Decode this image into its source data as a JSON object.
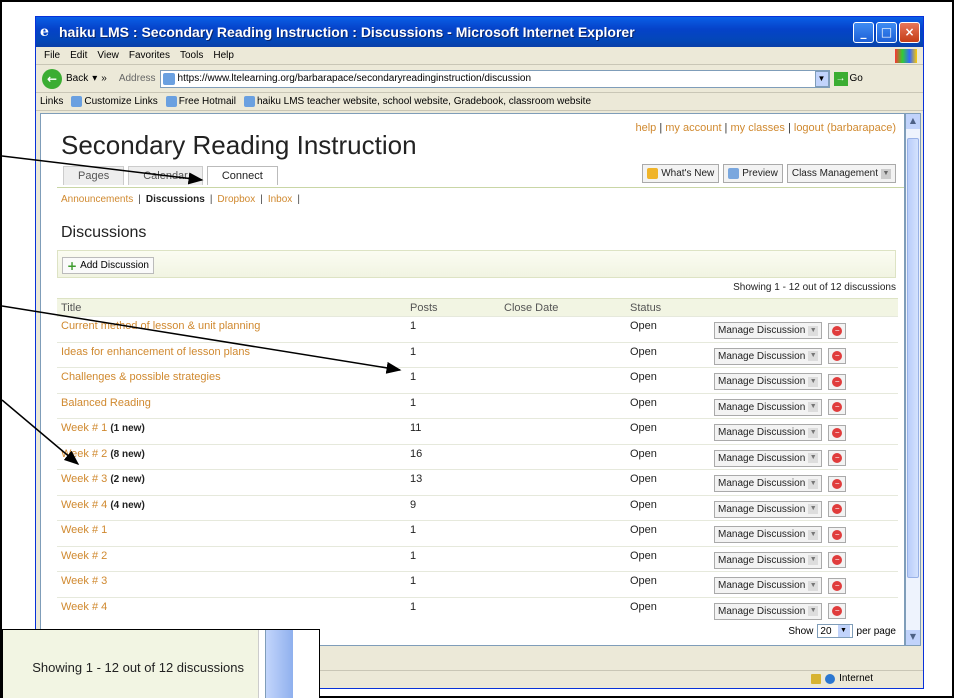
{
  "window": {
    "title": "haiku LMS : Secondary Reading Instruction : Discussions - Microsoft Internet Explorer",
    "menu": [
      "File",
      "Edit",
      "View",
      "Favorites",
      "Tools",
      "Help"
    ],
    "back_label": "Back",
    "address_label": "Address",
    "url": "https://www.ltelearning.org/barbarapace/secondaryreadinginstruction/discussion",
    "go_label": "Go",
    "links_label": "Links",
    "links": [
      "Customize Links",
      "Free Hotmail",
      "haiku LMS teacher website, school website, Gradebook, classroom website"
    ],
    "status_zone": "Internet"
  },
  "lms": {
    "top_links": [
      "help",
      "my account",
      "my classes",
      "logout (barbarapace)"
    ],
    "course_title": "Secondary Reading Instruction",
    "tabs": [
      "Pages",
      "Calendar",
      "Connect"
    ],
    "buttons": [
      "What's New",
      "Preview",
      "Class Management"
    ],
    "subnav": [
      "Announcements",
      "Discussions",
      "Dropbox",
      "Inbox"
    ],
    "page_heading": "Discussions",
    "add_button": "Add Discussion",
    "showing": "Showing 1 - 12 out of 12 discussions",
    "columns": [
      "Title",
      "Posts",
      "Close Date",
      "Status"
    ],
    "rows": [
      {
        "title": "Current method of lesson & unit planning",
        "new": "",
        "posts": "1",
        "close": "",
        "status": "Open"
      },
      {
        "title": "Ideas for enhancement of lesson plans",
        "new": "",
        "posts": "1",
        "close": "",
        "status": "Open"
      },
      {
        "title": "Challenges & possible strategies",
        "new": "",
        "posts": "1",
        "close": "",
        "status": "Open"
      },
      {
        "title": "Balanced Reading",
        "new": "",
        "posts": "1",
        "close": "",
        "status": "Open"
      },
      {
        "title": "Week # 1",
        "new": "(1 new)",
        "posts": "11",
        "close": "",
        "status": "Open"
      },
      {
        "title": "Week # 2",
        "new": "(8 new)",
        "posts": "16",
        "close": "",
        "status": "Open"
      },
      {
        "title": "Week # 3",
        "new": "(2 new)",
        "posts": "13",
        "close": "",
        "status": "Open"
      },
      {
        "title": "Week # 4",
        "new": "(4 new)",
        "posts": "9",
        "close": "",
        "status": "Open"
      },
      {
        "title": "Week # 1",
        "new": "",
        "posts": "1",
        "close": "",
        "status": "Open"
      },
      {
        "title": "Week # 2",
        "new": "",
        "posts": "1",
        "close": "",
        "status": "Open"
      },
      {
        "title": "Week # 3",
        "new": "",
        "posts": "1",
        "close": "",
        "status": "Open"
      },
      {
        "title": "Week # 4",
        "new": "",
        "posts": "1",
        "close": "",
        "status": "Open"
      }
    ],
    "manage_label": "Manage Discussion",
    "show_label": "Show",
    "per_page_value": "20",
    "per_page_label": "per page"
  },
  "callout": {
    "zoom_text": "Showing 1 - 12 out of 12 discussions"
  },
  "colors": {
    "link_orange": "#d0892f",
    "title_bar_blue": "#0542c9"
  }
}
